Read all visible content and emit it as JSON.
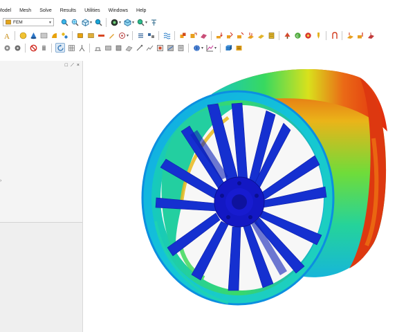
{
  "menu": [
    "Model",
    "Mesh",
    "Solve",
    "Results",
    "Utilities",
    "Windows",
    "Help"
  ],
  "toolbar": {
    "module_select": "FEM",
    "row1_icons": [
      "zoom-in-icon",
      "zoom-window-icon",
      "view-cube-icon",
      "fit-view-icon",
      "display-mode-icon",
      "iso-view-icon",
      "zoom-options-icon",
      "clipping-icon"
    ],
    "row2_icons": [
      "text-annotation-icon",
      "sphere-icon",
      "cone-icon",
      "image-icon",
      "shape-icon",
      "node-group-icon",
      "box-geometry-icon",
      "mesh-tool-icon",
      "beam-icon",
      "pen-icon",
      "target-icon",
      "stack-icon",
      "equation-icon",
      "wave-icon",
      "load-icon",
      "transform-icon",
      "plate-icon",
      "load-arrow-icon",
      "spring-icon",
      "force-icon",
      "surface-load-icon",
      "plate-load-icon",
      "stack-load-icon",
      "tree-icon",
      "prefix-icon",
      "color-icon",
      "result-icon",
      "vector-icon",
      "constraint-icon",
      "displacement-icon"
    ],
    "row3_icons": [
      "grid-icon",
      "refresh-icon",
      "no-entry-icon",
      "cylinder-icon",
      "rotate-icon",
      "mesh-grid-icon",
      "structure-icon",
      "scale-icon",
      "section-icon",
      "layer-icon",
      "element-icon",
      "probe-icon",
      "chart-icon",
      "frame-icon",
      "contour-icon",
      "animation-icon",
      "globe-icon",
      "graph-icon",
      "box3d-icon",
      "palette-icon"
    ]
  },
  "panel": {
    "controls": [
      "□",
      "⟋",
      "×"
    ],
    "edge_marker": "›"
  },
  "viewport": {
    "model": "wheel-rim-stress-contour",
    "colormap": [
      "#1216c9",
      "#0b8ee6",
      "#19d6c0",
      "#2fe04d",
      "#e6e21c",
      "#e3410f"
    ]
  }
}
